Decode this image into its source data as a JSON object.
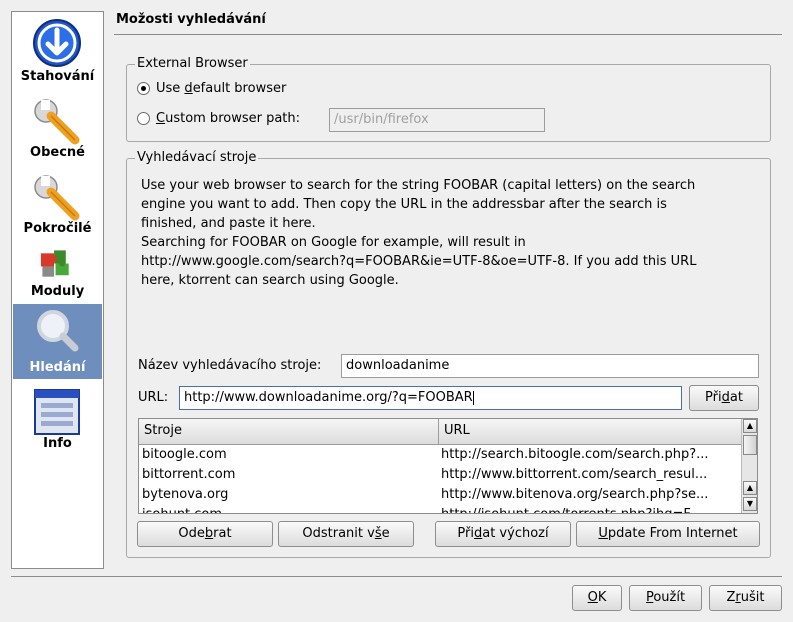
{
  "sidebar": {
    "items": [
      {
        "label": "Stahování",
        "icon": "download-arrow-icon"
      },
      {
        "label": "Obecné",
        "icon": "wrench-icon"
      },
      {
        "label": "Pokročilé",
        "icon": "wrench-icon"
      },
      {
        "label": "Moduly",
        "icon": "puzzle-icon"
      },
      {
        "label": "Hledání",
        "icon": "magnifier-icon",
        "active": true
      },
      {
        "label": "Info",
        "icon": "info-window-icon"
      }
    ]
  },
  "page": {
    "title": "Možosti vyhledávání"
  },
  "browser_group": {
    "legend": "External Browser",
    "default_option": {
      "prefix": "Use ",
      "accel": "d",
      "suffix": "efault browser",
      "selected": true
    },
    "custom_option": {
      "accel": "C",
      "suffix": "ustom browser path:",
      "selected": false
    },
    "path_value": "/usr/bin/firefox"
  },
  "engines_group": {
    "legend": "Vyhledávací stroje",
    "description": [
      "Use your web browser to search for the string FOOBAR (capital letters) on the search",
      "engine you want to add. Then copy the URL in the addressbar after the search is",
      "finished, and paste it here.",
      "Searching for FOOBAR on Google for example, will result in",
      "http://www.google.com/search?q=FOOBAR&ie=UTF-8&oe=UTF-8. If you add this URL",
      "here, ktorrent can search using Google."
    ],
    "name_label": "Název vyhledávacího stroje:",
    "name_value": "downloadanime",
    "url_label": "URL:",
    "url_value": "http://www.downloadanime.org/?q=FOOBAR",
    "add_button": {
      "prefix": "Při",
      "accel": "d",
      "suffix": "at"
    },
    "table": {
      "columns": [
        "Stroje",
        "URL"
      ],
      "rows": [
        {
          "name": "bitoogle.com",
          "url": "http://search.bitoogle.com/search.php?..."
        },
        {
          "name": "bittorrent.com",
          "url": "http://www.bittorrent.com/search_resul..."
        },
        {
          "name": "bytenova.org",
          "url": "http://www.bitenova.org/search.php?se..."
        },
        {
          "name": "isohunt.com",
          "url": "http://isohunt.com/torrents.php?ihq=F..."
        }
      ]
    },
    "buttons": {
      "remove": {
        "prefix": "Ode",
        "accel": "b",
        "suffix": "rat"
      },
      "remove_all": {
        "prefix": "Odstranit v",
        "accel": "š",
        "suffix": "e"
      },
      "add_default": {
        "prefix": "Při",
        "accel": "d",
        "suffix": "at výchozí"
      },
      "update": {
        "prefix": "",
        "accel": "U",
        "suffix": "pdate From Internet"
      }
    }
  },
  "dialog_buttons": {
    "ok": {
      "prefix": "",
      "accel": "O",
      "suffix": "K"
    },
    "apply": {
      "prefix": "",
      "accel": "P",
      "suffix": "oužít"
    },
    "cancel": {
      "prefix": "Z",
      "accel": "r",
      "suffix": "ušit"
    }
  },
  "colors": {
    "active_sidebar": "#6e8fbd",
    "accent_blue": "#2a5fc8",
    "wrench_orange": "#f0a020"
  }
}
